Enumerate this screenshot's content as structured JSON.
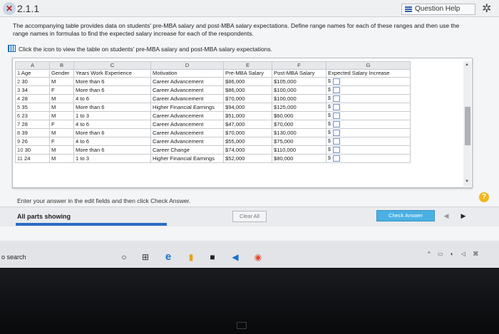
{
  "header": {
    "problem_id": "2.1.1",
    "question_help_label": "Question Help"
  },
  "instructions": "The accompanying table provides data on students' pre-MBA salary and post-MBA salary expectations. Define range names for each of these ranges and then use the range names in formulas to find the expected salary increase for each of the respondents.",
  "view_link": "Click the icon to view the table on students' pre-MBA salary and post-MBA salary expectations.",
  "sheet": {
    "column_letters": [
      "A",
      "B",
      "C",
      "D",
      "E",
      "F",
      "G"
    ],
    "headers": [
      "Age",
      "Gender",
      "Years Work Experience",
      "Motivation",
      "Pre-MBA Salary",
      "Post-MBA Salary",
      "Expected Salary Increase"
    ],
    "rows": [
      {
        "n": "2",
        "age": "30",
        "gender": "M",
        "exp": "More than 6",
        "mot": "Career Advancement",
        "pre": "$86,000",
        "post": "$105,000",
        "inc": "$"
      },
      {
        "n": "3",
        "age": "34",
        "gender": "F",
        "exp": "More than 6",
        "mot": "Career Advancement",
        "pre": "$86,000",
        "post": "$100,000",
        "inc": "$"
      },
      {
        "n": "4",
        "age": "28",
        "gender": "M",
        "exp": "4 to 6",
        "mot": "Career Advancement",
        "pre": "$70,000",
        "post": "$100,000",
        "inc": "$"
      },
      {
        "n": "5",
        "age": "35",
        "gender": "M",
        "exp": "More than 6",
        "mot": "Higher Financial Earnings",
        "pre": "$94,000",
        "post": "$125,000",
        "inc": "$"
      },
      {
        "n": "6",
        "age": "23",
        "gender": "M",
        "exp": "1 to 3",
        "mot": "Career Advancement",
        "pre": "$51,000",
        "post": "$60,000",
        "inc": "$"
      },
      {
        "n": "7",
        "age": "28",
        "gender": "F",
        "exp": "4 to 6",
        "mot": "Career Advancement",
        "pre": "$47,000",
        "post": "$70,000",
        "inc": "$"
      },
      {
        "n": "8",
        "age": "39",
        "gender": "M",
        "exp": "More than 6",
        "mot": "Career Advancement",
        "pre": "$70,000",
        "post": "$130,000",
        "inc": "$"
      },
      {
        "n": "9",
        "age": "26",
        "gender": "F",
        "exp": "4 to 6",
        "mot": "Career Advancement",
        "pre": "$55,000",
        "post": "$75,000",
        "inc": "$"
      },
      {
        "n": "10",
        "age": "30",
        "gender": "M",
        "exp": "More than 6",
        "mot": "Career Change",
        "pre": "$74,000",
        "post": "$110,000",
        "inc": "$"
      },
      {
        "n": "11",
        "age": "24",
        "gender": "M",
        "exp": "1 to 3",
        "mot": "Higher Financial Earnings",
        "pre": "$52,000",
        "post": "$80,000",
        "inc": "$"
      }
    ]
  },
  "enter_message": "Enter your answer in the edit fields and then click Check Answer.",
  "footer": {
    "parts_label": "All parts showing",
    "clear_label": "Clear All",
    "check_label": "Check Answer"
  },
  "taskbar": {
    "search_text": "o search"
  },
  "colors": {
    "accent_blue": "#2b6cc4",
    "check_button": "#4ab0e3",
    "help_badge": "#f2b61b"
  }
}
